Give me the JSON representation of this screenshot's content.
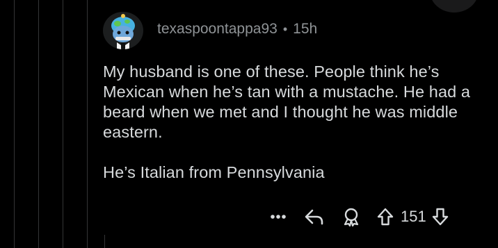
{
  "comment": {
    "username": "texaspoontappa93",
    "separator": "•",
    "age": "15h",
    "paragraphs": [
      "My husband is one of these. People think he’s Mexican when he’s tan with a mustache. He had a beard when we met and I thought he was middle eastern.",
      "He’s Italian from Pennsylvania"
    ],
    "actions": {
      "more_icon": "more-options-icon",
      "reply_icon": "reply-icon",
      "award_icon": "award-icon",
      "upvote_icon": "upvote-icon",
      "vote_count": "151",
      "downvote_icon": "downvote-icon"
    }
  },
  "colors": {
    "background": "#000000",
    "text": "#d7dadc",
    "meta_text": "#8f9396",
    "thread_line": "#343536"
  }
}
